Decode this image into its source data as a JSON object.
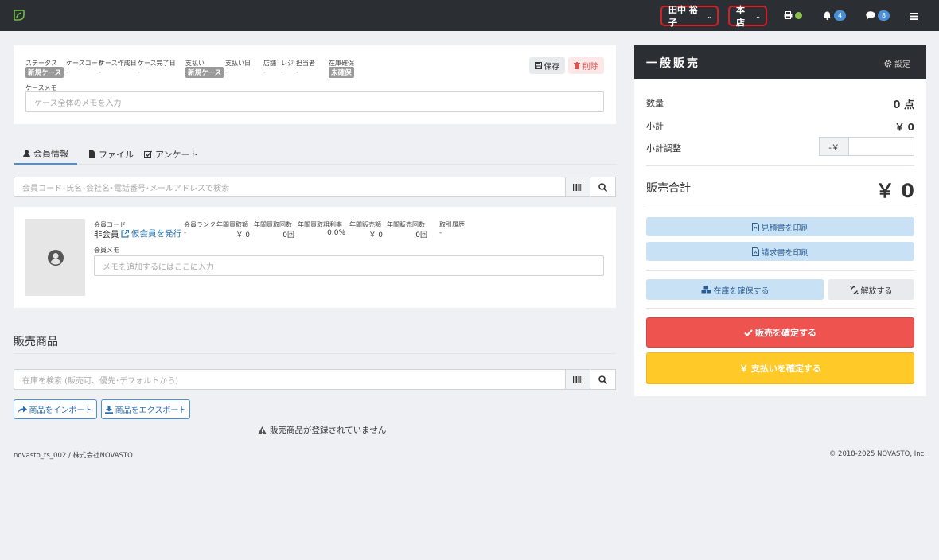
{
  "nav": {
    "user_name": "田中 裕子",
    "store": "本店",
    "notif_count": "4",
    "message_count": "8"
  },
  "case": {
    "status_label": "ステータス",
    "status_value": "新規ケース",
    "case_code_label": "ケースコード",
    "case_code_value": "-",
    "created_label": "ケース作成日",
    "created_value": "-",
    "completed_label": "ケース完了日",
    "completed_value": "-",
    "payment_label": "支払い",
    "payment_value": "新規ケース",
    "payment_date_label": "支払い日",
    "payment_date_value": "-",
    "store_label": "店舗",
    "store_value": "-",
    "register_label": "レジ",
    "register_value": "-",
    "staff_label": "担当者",
    "staff_value": "-",
    "stock_label": "在庫確保",
    "stock_value": "未確保",
    "save_label": "保存",
    "delete_label": "削除",
    "memo_label": "ケースメモ",
    "memo_placeholder": "ケース全体のメモを入力"
  },
  "tabs": [
    {
      "label": "会員情報"
    },
    {
      "label": "ファイル"
    },
    {
      "label": "アンケート"
    }
  ],
  "member_search": {
    "placeholder": "会員コード･氏名･会社名･電話番号･メールアドレスで検索"
  },
  "member": {
    "code_label": "会員コード",
    "code_value": "非会員",
    "issue_link": "仮会員を発行",
    "rank_label": "会員ランク",
    "rank_value": "-",
    "annual_purchase_label": "年間買取額",
    "annual_purchase_value": "￥ 0",
    "annual_purchase_count_label": "年間買取回数",
    "annual_purchase_count_value": "0回",
    "annual_purchase_margin_label": "年間買取粗利率",
    "annual_purchase_margin_value": "0.0%",
    "annual_sales_label": "年間販売額",
    "annual_sales_value": "￥ 0",
    "annual_sales_count_label": "年間販売回数",
    "annual_sales_count_value": "0回",
    "history_label": "取引履歴",
    "history_value": "-",
    "memo_label": "会員メモ",
    "memo_placeholder": "メモを追加するにはここに入力"
  },
  "products": {
    "heading": "販売商品",
    "search_placeholder": "在庫を検索 (販売可、優先･デフォルトから)",
    "import_label": "商品をインポート",
    "export_label": "商品をエクスポート",
    "empty_message": "販売商品が登録されていません"
  },
  "footer": {
    "left": "novasto_ts_002 / 株式会社NOVASTO",
    "right": "© 2018-2025 NOVASTO, Inc."
  },
  "sale": {
    "title": "一般販売",
    "settings_label": "設定",
    "qty_label": "数量",
    "qty_value": "0 点",
    "subtotal_label": "小計",
    "subtotal_value": "￥ 0",
    "adjust_label": "小計調整",
    "adjust_prefix": "-￥",
    "total_label": "販売合計",
    "total_value": "￥ 0",
    "estimate_label": "見積書を印刷",
    "invoice_label": "請求書を印刷",
    "reserve_label": "在庫を確保する",
    "release_label": "解放する",
    "confirm_sale_label": "販売を確定する",
    "confirm_payment_label": "￥ 支払いを確定する"
  },
  "colors": {
    "nav_bg": "#2b2e33",
    "accent_red": "#ef5350",
    "accent_yellow": "#ffca28",
    "highlight_border": "#d61f26",
    "link_blue": "#2a7ab9"
  }
}
